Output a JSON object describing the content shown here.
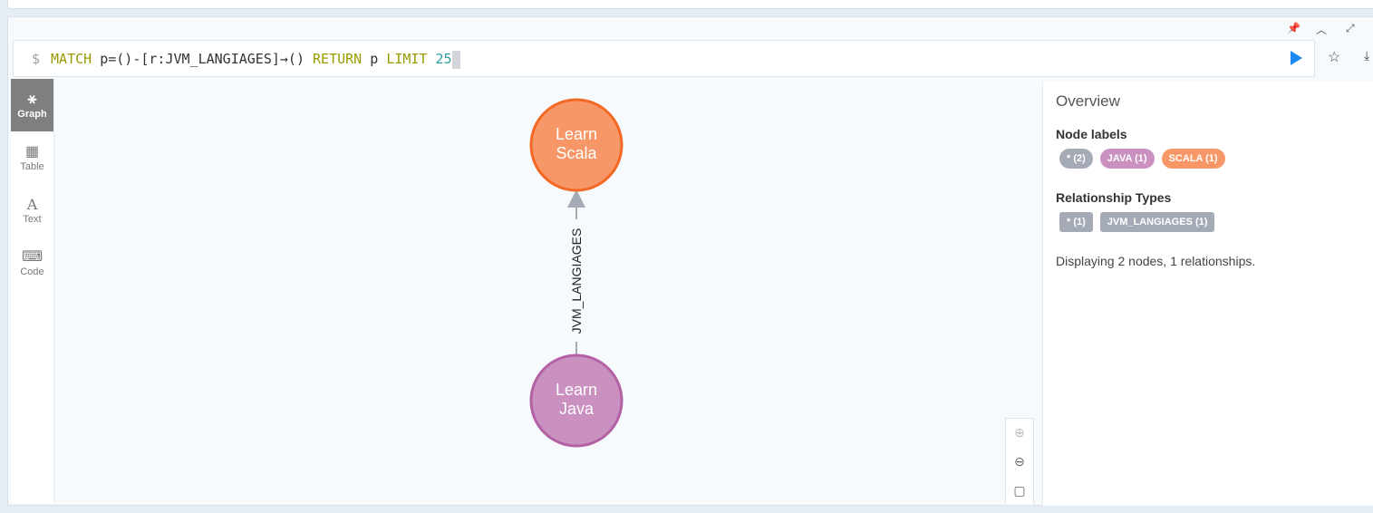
{
  "query": {
    "prompt": "$",
    "parts": [
      {
        "t": "MATCH",
        "c": "kw"
      },
      {
        "t": " p=()-[r:JVM_LANGIAGES]→() ",
        "c": "id"
      },
      {
        "t": "RETURN",
        "c": "kw"
      },
      {
        "t": " p ",
        "c": "id"
      },
      {
        "t": "LIMIT",
        "c": "kw"
      },
      {
        "t": " 25",
        "c": "num"
      }
    ]
  },
  "frame_controls": [
    "pin-icon",
    "collapse-icon",
    "fullscreen-icon"
  ],
  "sidebar": {
    "items": [
      {
        "label": "Graph",
        "icon": "graph-icon",
        "active": true
      },
      {
        "label": "Table",
        "icon": "table-icon"
      },
      {
        "label": "Text",
        "icon": "text-icon"
      },
      {
        "label": "Code",
        "icon": "code-icon"
      }
    ]
  },
  "graph": {
    "nodes": [
      {
        "id": "scala",
        "caption": [
          "Learn",
          "Scala"
        ],
        "label": "SCALA",
        "fill": "#f79767",
        "stroke": "#f36924"
      },
      {
        "id": "java",
        "caption": [
          "Learn",
          "Java"
        ],
        "label": "JAVA",
        "fill": "#c990c0",
        "stroke": "#b261a5"
      }
    ],
    "relationships": [
      {
        "from": "java",
        "to": "scala",
        "type": "JVM_LANGIAGES"
      }
    ]
  },
  "overview": {
    "title": "Overview",
    "node_labels_heading": "Node labels",
    "node_labels": [
      {
        "text": "* (2)",
        "color": "#a5abb6"
      },
      {
        "text": "JAVA (1)",
        "color": "#c990c0"
      },
      {
        "text": "SCALA (1)",
        "color": "#f79767"
      }
    ],
    "rel_types_heading": "Relationship Types",
    "rel_types": [
      {
        "text": "* (1)",
        "color": "#a5abb6"
      },
      {
        "text": "JVM_LANGIAGES (1)",
        "color": "#a5abb6"
      }
    ],
    "summary": "Displaying 2 nodes, 1 relationships."
  }
}
